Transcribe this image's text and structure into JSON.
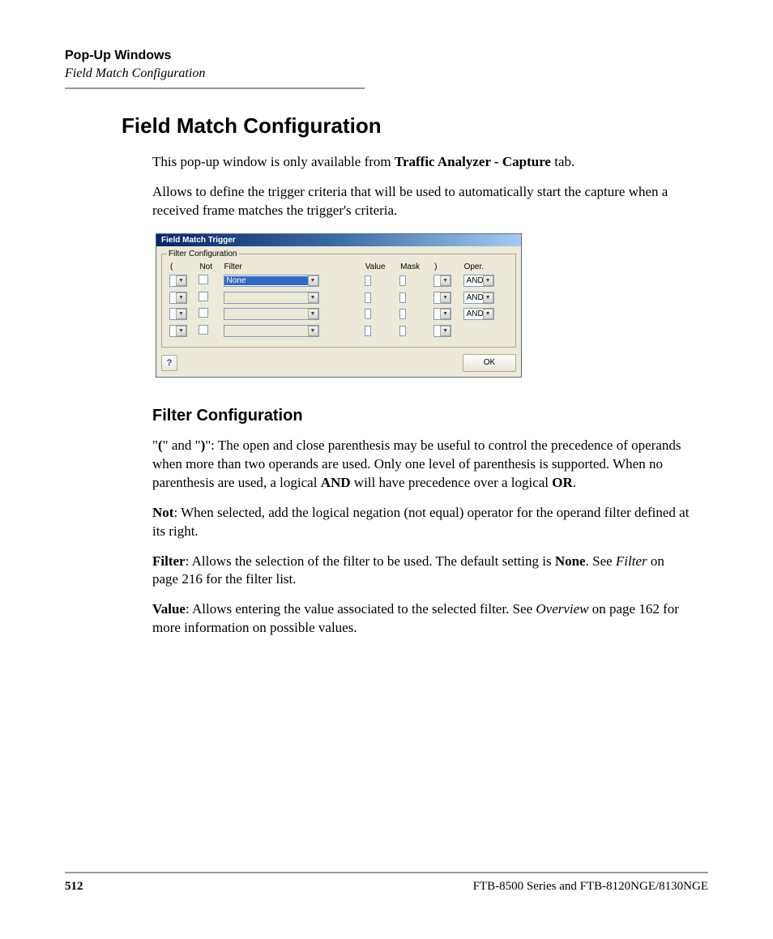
{
  "header": {
    "title": "Pop-Up Windows",
    "subtitle": "Field Match Configuration"
  },
  "main_title": "Field Match Configuration",
  "intro_p1_pre": "This pop-up window is only available from ",
  "intro_p1_bold": "Traffic Analyzer - Capture",
  "intro_p1_post": " tab.",
  "intro_p2": "Allows to define the trigger criteria that will be used to automatically start the capture when a received frame matches the trigger's criteria.",
  "dialog": {
    "title": "Field Match Trigger",
    "legend": "Filter Configuration",
    "columns": {
      "paren_open": "(",
      "not": "Not",
      "filter": "Filter",
      "value": "Value",
      "mask": "Mask",
      "paren_close": ")",
      "oper": "Oper."
    },
    "rows": [
      {
        "filter": "None",
        "filter_selected": true,
        "oper": "AND",
        "has_oper": true
      },
      {
        "filter": "",
        "filter_selected": false,
        "oper": "AND",
        "has_oper": true
      },
      {
        "filter": "",
        "filter_selected": false,
        "oper": "AND",
        "has_oper": true
      },
      {
        "filter": "",
        "filter_selected": false,
        "oper": "",
        "has_oper": false
      }
    ],
    "help": "?",
    "ok": "OK"
  },
  "section_title": "Filter Configuration",
  "p_paren_1": "\"",
  "p_paren_b1": "(",
  "p_paren_2": "\" and \"",
  "p_paren_b2": ")",
  "p_paren_3": "\": The open and close parenthesis may be useful to control the precedence of operands when more than two operands are used. Only one level of parenthesis is supported. When no parenthesis are used, a logical ",
  "p_paren_b3": "AND",
  "p_paren_4": " will have precedence over a logical ",
  "p_paren_b4": "OR",
  "p_paren_5": ".",
  "p_not_b": "Not",
  "p_not_t": ": When selected, add the logical negation (not equal) operator for the operand filter defined at its right.",
  "p_filter_b": "Filter",
  "p_filter_t1": ": Allows the selection of the filter to be used. The default setting is ",
  "p_filter_b2": "None",
  "p_filter_t2": ". See ",
  "p_filter_i": "Filter",
  "p_filter_t3": " on page 216 for the filter list.",
  "p_value_b": "Value",
  "p_value_t1": ": Allows entering the value associated to the selected filter. See ",
  "p_value_i": "Overview",
  "p_value_t2": " on page 162 for more information on possible values.",
  "footer": {
    "page": "512",
    "product": "FTB-8500 Series and FTB-8120NGE/8130NGE"
  }
}
